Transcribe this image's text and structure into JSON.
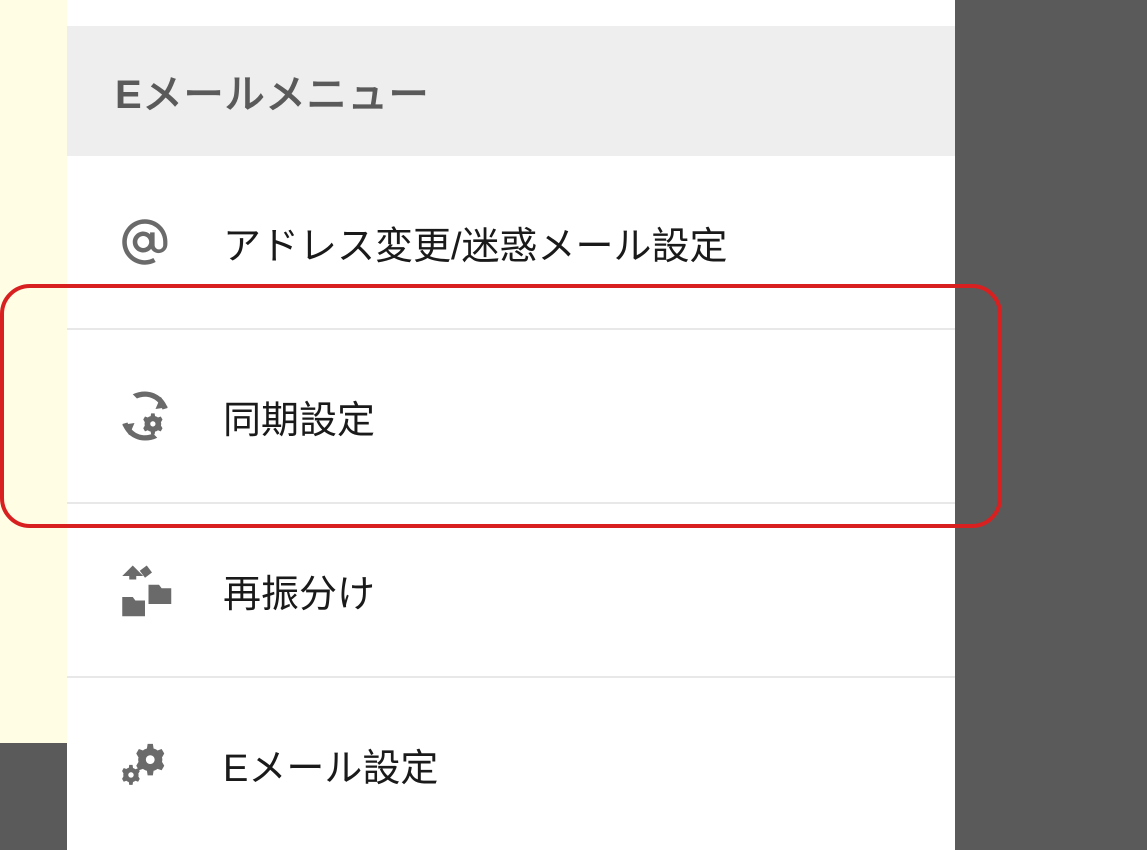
{
  "menu": {
    "header_title": "Eメールメニュー",
    "items": [
      {
        "label": "アドレス変更/迷惑メール設定",
        "icon": "at-icon"
      },
      {
        "label": "同期設定",
        "icon": "sync-gear-icon"
      },
      {
        "label": "再振分け",
        "icon": "folder-sort-icon"
      },
      {
        "label": "Eメール設定",
        "icon": "gear-icon"
      }
    ]
  },
  "highlight": {
    "target_index": 1
  }
}
